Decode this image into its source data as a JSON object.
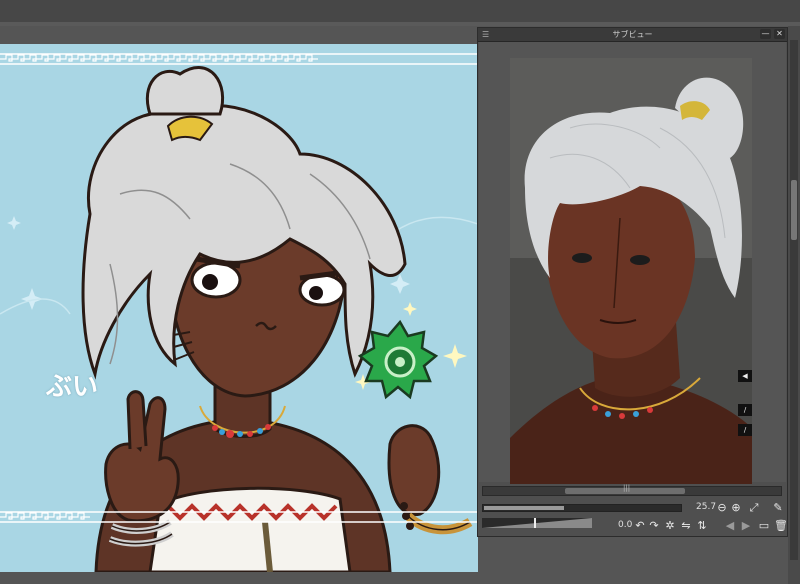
{
  "art": {
    "caption": "ぶい",
    "background_color": "#a9d6e4"
  },
  "subview": {
    "title": "サブビュー",
    "menu_icon": "menu-lines-icon",
    "zoom_value": "25.7",
    "rotation_value": "0.0",
    "scroll_grip": "|||",
    "hud_arrow": "◀",
    "hud_mid": "/",
    "hud_bottom": "/"
  }
}
